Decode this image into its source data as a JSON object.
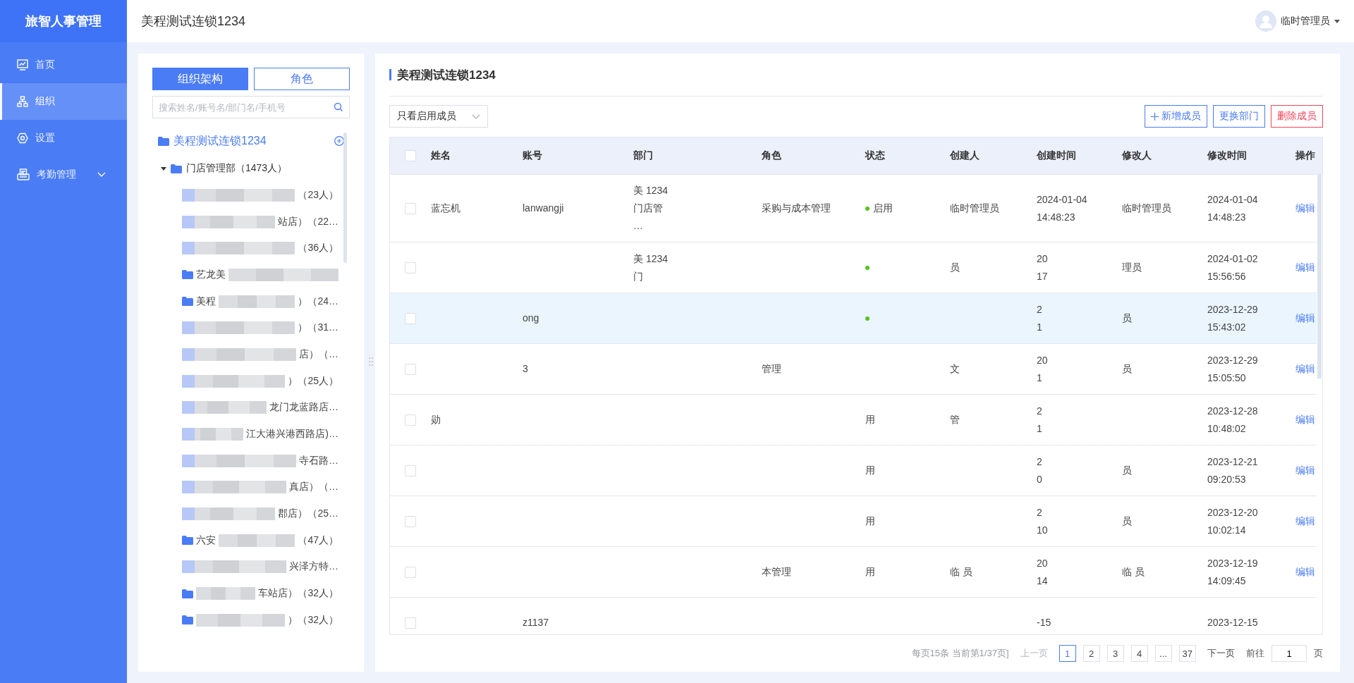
{
  "sidebar": {
    "logo": "旅智人事管理",
    "items": [
      {
        "label": "首页",
        "selected": false
      },
      {
        "label": "组织",
        "selected": true
      },
      {
        "label": "设置",
        "selected": false
      },
      {
        "label": "考勤管理",
        "selected": false,
        "expanded": false
      }
    ]
  },
  "header": {
    "title": "美程测试连锁1234",
    "user": "临时管理员"
  },
  "left_panel": {
    "tabs": [
      {
        "label": "组织架构",
        "selected": true
      },
      {
        "label": "角色",
        "selected": false
      }
    ],
    "search": {
      "placeholder": "搜索姓名/账号名/部门名/手机号"
    },
    "tree": {
      "label": "美程测试连锁1234",
      "children": [
        {
          "label": "门店管理部（1473人）",
          "expanded": true,
          "children": [
            {
              "label": "（23人）",
              "folder": false,
              "redacted": true
            },
            {
              "label": "站店）（22…",
              "folder": false,
              "redacted": true
            },
            {
              "label": "（36人）",
              "folder": false,
              "redacted": true
            },
            {
              "prefix": "艺龙美",
              "folder": true,
              "redacted": true
            },
            {
              "prefix": "美程",
              "label": "）（24…",
              "folder": true,
              "redacted": true
            },
            {
              "label": "）（31…",
              "folder": false,
              "redacted": true
            },
            {
              "label": "店）（…",
              "folder": false,
              "redacted": true
            },
            {
              "label": "）（25人）",
              "folder": false,
              "redacted": true
            },
            {
              "label": "龙门龙蓝路店…",
              "folder": false,
              "redacted": true
            },
            {
              "label": "江大港兴港西路店)…",
              "folder": false,
              "redacted": true
            },
            {
              "label": "寺石路…",
              "folder": false,
              "redacted": true
            },
            {
              "label": "真店）（…",
              "folder": false,
              "redacted": true
            },
            {
              "label": "郡店）（25…",
              "folder": false,
              "redacted": true
            },
            {
              "prefix": "六安",
              "label": "（47人）",
              "folder": true,
              "redacted": true
            },
            {
              "label": "兴泽方特…",
              "folder": false,
              "redacted": true
            },
            {
              "label": "车站店）（32人）",
              "folder": true,
              "redacted": true
            },
            {
              "label": "）（32人）",
              "folder": true,
              "redacted": true
            }
          ]
        }
      ]
    }
  },
  "main": {
    "title": "美程测试连锁1234",
    "filter": "只看启用成员",
    "buttons": [
      {
        "label": "新增成员",
        "kind": "add"
      },
      {
        "label": "更换部门",
        "kind": "normal"
      },
      {
        "label": "删除成员",
        "kind": "danger"
      }
    ],
    "table": {
      "header_checked": false,
      "columns": [
        "姓名",
        "账号",
        "部门",
        "角色",
        "状态",
        "创建人",
        "创建时间",
        "修改人",
        "修改时间",
        "操作"
      ],
      "rows": [
        {
          "selected": false,
          "checked": false,
          "name": "蓝忘机",
          "account": "lanwangji",
          "dept": [
            "美 1234",
            "门店管",
            "…"
          ],
          "role": "采购与成本管理",
          "status": "启用",
          "color": "#52c41a",
          "creator": "临时管理员",
          "created": [
            "2024-01-04",
            "14:48:23"
          ],
          "modifier": "临时管理员",
          "modified": [
            "2024-01-04",
            "14:48:23"
          ],
          "action": "编辑"
        },
        {
          "selected": false,
          "checked": false,
          "dept": [
            "美 1234",
            "门"
          ],
          "color": "#52c41a",
          "creator": "员",
          "created": [
            "20",
            "17"
          ],
          "modifier": "理员",
          "modified": [
            "2024-01-02",
            "15:56:56"
          ],
          "action": "编辑"
        },
        {
          "selected": true,
          "checked": false,
          "account": "ong",
          "color": "#52c41a",
          "created": [
            "2",
            "1"
          ],
          "modifier": "员",
          "modified": [
            "2023-12-29",
            "15:43:02"
          ],
          "action": "编辑"
        },
        {
          "selected": false,
          "checked": false,
          "account": "3",
          "role": "管理",
          "creator": "文",
          "created": [
            "20",
            "1"
          ],
          "modifier": "员",
          "modified": [
            "2023-12-29",
            "15:05:50"
          ],
          "action": "编辑"
        },
        {
          "selected": false,
          "checked": false,
          "name": "勋",
          "status": "用",
          "creator": "管",
          "created": [
            "2",
            "1"
          ],
          "modified": [
            "2023-12-28",
            "10:48:02"
          ],
          "action": "编辑"
        },
        {
          "selected": false,
          "checked": false,
          "status": "用",
          "created": [
            "2",
            "0"
          ],
          "modifier": "员",
          "modified": [
            "2023-12-21",
            "09:20:53"
          ],
          "action": "编辑"
        },
        {
          "selected": false,
          "checked": false,
          "status": "用",
          "created": [
            "2",
            "10"
          ],
          "modifier": "员",
          "modified": [
            "2023-12-20",
            "10:02:14"
          ],
          "action": "编辑"
        },
        {
          "selected": false,
          "checked": false,
          "role": "本管理",
          "status": "用",
          "creator": "临 员",
          "created": [
            "20",
            "14"
          ],
          "modifier": "临 员",
          "modified": [
            "2023-12-19",
            "14:09:45"
          ],
          "action": "编辑"
        },
        {
          "selected": false,
          "checked": false,
          "account": "z1137",
          "created": [
            "-15"
          ],
          "modified": [
            "2023-12-15"
          ]
        }
      ]
    },
    "pagination": {
      "summary": "每页15条 当前第1/37页]",
      "prev": "上一页",
      "pages": [
        {
          "label": "1",
          "selected": true
        },
        {
          "label": "2",
          "selected": false
        },
        {
          "label": "3",
          "selected": false
        },
        {
          "label": "4",
          "selected": false
        },
        {
          "label": "...",
          "selected": false
        },
        {
          "label": "37",
          "selected": false
        }
      ],
      "next": "下一页",
      "goto": "前往",
      "page_value": "1",
      "page_unit": "页"
    }
  }
}
